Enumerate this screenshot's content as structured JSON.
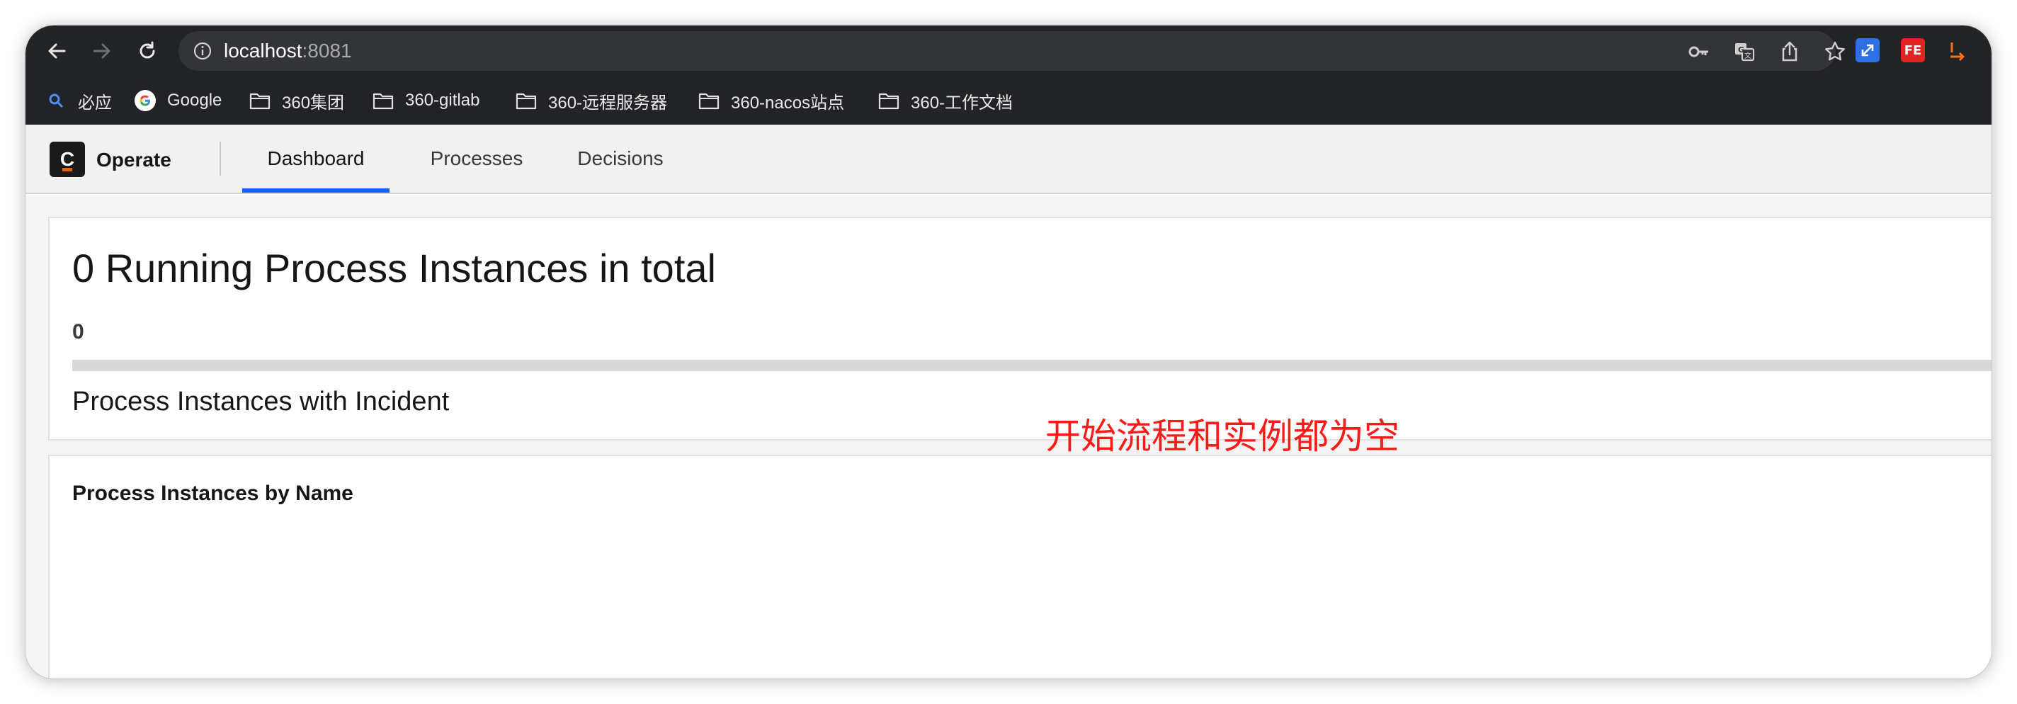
{
  "browser": {
    "url_host": "localhost",
    "url_port": ":8081",
    "toolbar_icons": [
      "back-icon",
      "forward-icon",
      "reload-icon",
      "info-icon",
      "key-icon",
      "translate-icon",
      "share-icon",
      "star-icon"
    ],
    "extensions": [
      {
        "name": "ext-blue-arrow",
        "color": "#3b82f6",
        "label": ""
      },
      {
        "name": "ext-fe",
        "color": "#e02424",
        "label": "FE"
      },
      {
        "name": "ext-orange",
        "color": "#f97316",
        "label": ""
      }
    ]
  },
  "bookmarks": [
    {
      "label": "必应",
      "icon": "search-icon"
    },
    {
      "label": "Google",
      "icon": "google-icon"
    },
    {
      "label": "360集团",
      "icon": "folder-icon"
    },
    {
      "label": "360-gitlab",
      "icon": "folder-icon"
    },
    {
      "label": "360-远程服务器",
      "icon": "folder-icon"
    },
    {
      "label": "360-nacos站点",
      "icon": "folder-icon"
    },
    {
      "label": "360-工作文档",
      "icon": "folder-icon"
    }
  ],
  "app": {
    "logo_letter": "C",
    "brand": "Operate",
    "tabs": [
      {
        "label": "Dashboard",
        "active": true
      },
      {
        "label": "Processes",
        "active": false
      },
      {
        "label": "Decisions",
        "active": false
      }
    ],
    "accent_color": "#0f62fe"
  },
  "dashboard": {
    "running_title": "0 Running Process Instances in total",
    "running_count": "0",
    "incident_label": "Process Instances with Incident",
    "by_name_title": "Process Instances by Name"
  },
  "annotation": {
    "text": "开始流程和实例都为空",
    "color": "#ff1a1a"
  }
}
